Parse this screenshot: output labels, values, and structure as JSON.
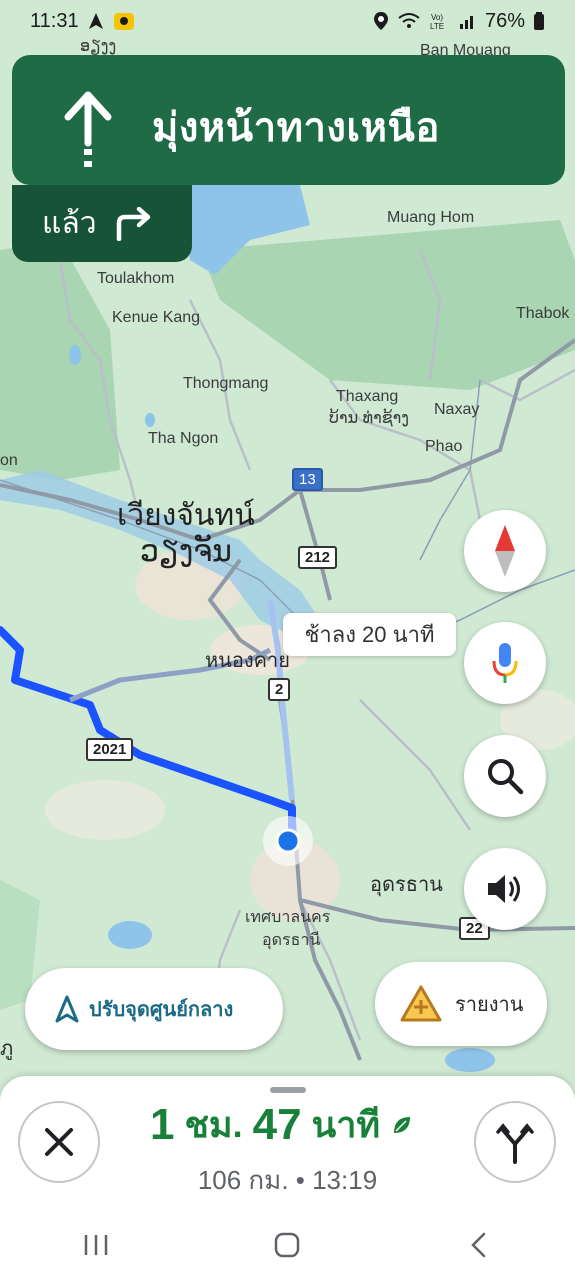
{
  "status_bar": {
    "time": "11:31",
    "battery": "76%"
  },
  "instruction": {
    "primary": "มุ่งหน้าทางเหนือ",
    "then_label": "แล้ว"
  },
  "map": {
    "labels": {
      "top_left": "ອຽງງ",
      "ban_mouang": "Ban Mouang",
      "muang_hom": "Muang Hom",
      "toulakhom": "Toulakhom",
      "kenue_kang": "Kenue Kang",
      "thabok": "Thabok",
      "thongmang": "Thongmang",
      "thaxang": "Thaxang",
      "thaxang_lao": "ບ້ານ ທ່າຊ້າງ",
      "naxay": "Naxay",
      "tha_ngon": "Tha Ngon",
      "phao": "Phao",
      "on": "on",
      "vientiane_th": "เวียงจันทน์",
      "vientiane_lao": "ວຽງຈັນ",
      "nong_khai": "หนองคาย",
      "udon_right": "อุดรธาน",
      "udon_muni_1": "เทศบาลนคร",
      "udon_muni_2": "อุดรธานี",
      "left_bottom": "ภู"
    },
    "shields": {
      "r13": "13",
      "r212": "212",
      "r2": "2",
      "r2021": "2021",
      "r22": "22"
    },
    "delay_chip": "ช้าลง 20 นาที"
  },
  "buttons": {
    "recenter": "ปรับจุดศูนย์กลาง",
    "report": "รายงาน"
  },
  "trip": {
    "hours": "1",
    "hours_unit": "ชม.",
    "minutes": "47",
    "minutes_unit": "นาที",
    "distance_arrival": "106 กม. • 13:19"
  },
  "colors": {
    "nav_green": "#1e6b45",
    "route_blue": "#1a53ff",
    "eta_green": "#188038"
  }
}
